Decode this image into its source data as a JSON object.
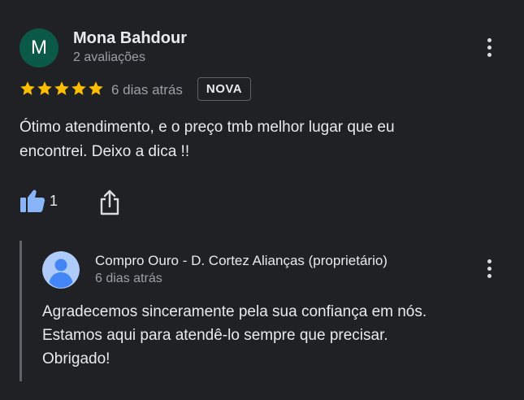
{
  "review": {
    "avatar_letter": "M",
    "avatar_color": "#0b5a47",
    "reviewer_name": "Mona Bahdour",
    "reviewer_review_count": "2 avaliações",
    "rating": 5,
    "rating_max": 5,
    "star_color": "#fbbc04",
    "date": "6 dias atrás",
    "badge": "NOVA",
    "text_line1": "Ótimo atendimento, e o preço tmb melhor lugar que eu",
    "text_line2": "encontrei. Deixo a dica !!",
    "like_count": "1",
    "icons": {
      "menu": "more-vert-icon",
      "like": "thumb-up-icon",
      "share": "share-icon"
    }
  },
  "owner_reply": {
    "name": "Compro Ouro - D. Cortez Alianças (proprietário)",
    "date": "6 dias atrás",
    "line1": "Agradecemos sinceramente pela sua confiança em nós.",
    "line2": "Estamos aqui para atendê-lo sempre que precisar.",
    "line3": "Obrigado!",
    "avatar_color": "#aecbfa",
    "icons": {
      "avatar": "person-avatar-icon",
      "menu": "more-vert-icon"
    }
  },
  "colors": {
    "background": "#202124",
    "text": "#e8eaed",
    "secondary_text": "#9aa0a6",
    "accent_blue": "#8ab4f8"
  }
}
